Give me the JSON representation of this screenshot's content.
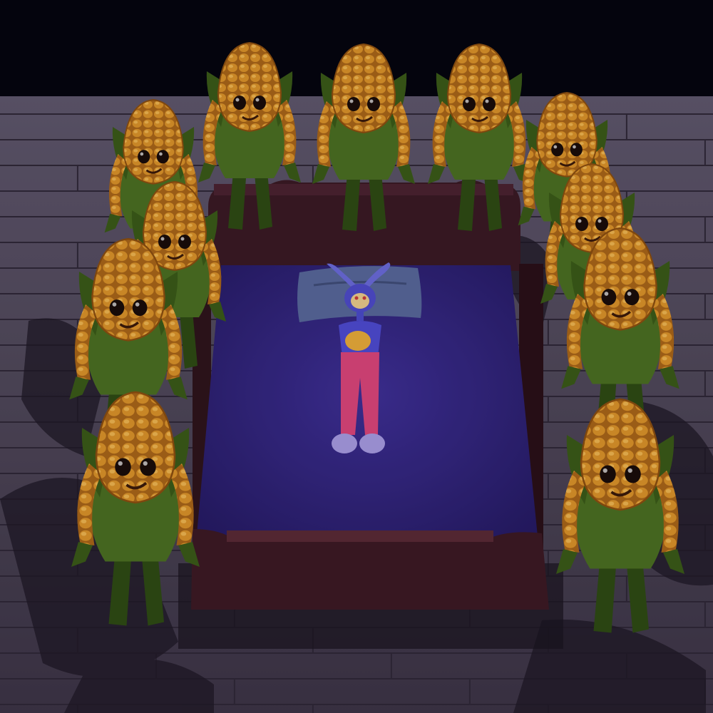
{
  "scene": {
    "colors": {
      "backdrop": "#05050f",
      "floor_light": "#6e6578",
      "floor_dark": "#3a3448",
      "floor_line": "#2a2434",
      "bed_frame": "#3a1a22",
      "bed_frame_dark": "#24101a",
      "mattress": "#3a2a8c",
      "mattress_dark": "#2a1d6e",
      "pillow": "#5a6a9a",
      "kernel": "#d9922a",
      "kernel_light": "#f2b54a",
      "husk": "#4a6e22",
      "husk_dark": "#2f4a14",
      "eye": "#1a0c0a",
      "jester_body": "#4a4ac8",
      "jester_pants": "#e0507a",
      "jester_shoes": "#9a90d8",
      "shadow": "#1a1420"
    },
    "corn_figures": [
      {
        "id": "back-1",
        "side": "back"
      },
      {
        "id": "back-2",
        "side": "back"
      },
      {
        "id": "back-3",
        "side": "back"
      },
      {
        "id": "left-1",
        "side": "left"
      },
      {
        "id": "left-2",
        "side": "left"
      },
      {
        "id": "left-3",
        "side": "left"
      },
      {
        "id": "left-4",
        "side": "left"
      },
      {
        "id": "right-1",
        "side": "right"
      },
      {
        "id": "right-2",
        "side": "right"
      },
      {
        "id": "right-3",
        "side": "right"
      },
      {
        "id": "right-4",
        "side": "right"
      }
    ],
    "bed": {
      "has_headboard": true,
      "has_footboard": true
    },
    "character": {
      "name_shown": false,
      "holding": "corn"
    }
  }
}
